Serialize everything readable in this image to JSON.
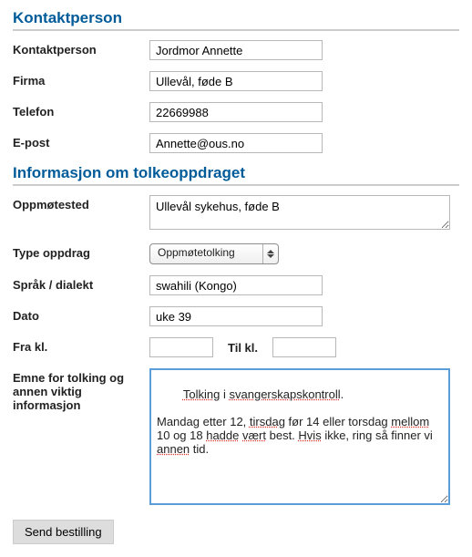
{
  "section1": {
    "title": "Kontaktperson"
  },
  "contact": {
    "person_label": "Kontaktperson",
    "person_value": "Jordmor Annette",
    "firm_label": "Firma",
    "firm_value": "Ullevål, føde B",
    "phone_label": "Telefon",
    "phone_value": "22669988",
    "email_label": "E-post",
    "email_value": "Annette@ous.no"
  },
  "section2": {
    "title": "Informasjon om tolkeoppdraget"
  },
  "job": {
    "meeting_label": "Oppmøtested",
    "meeting_value": "Ullevål sykehus, føde B",
    "type_label": "Type oppdrag",
    "type_value": "Oppmøtetolking",
    "language_label": "Språk / dialekt",
    "language_value": "swahili (Kongo)",
    "date_label": "Dato",
    "date_value": "uke 39",
    "from_label": "Fra kl.",
    "from_value": "",
    "to_label": "Til kl.",
    "to_value": "",
    "subject_label": "Emne for tolking og annen viktig informasjon",
    "subject_words": [
      {
        "t": "Tolking",
        "m": true
      },
      {
        "t": " i "
      },
      {
        "t": "svangerskapskontroll",
        "m": true
      },
      {
        "t": "."
      },
      {
        "t": "\n\n"
      },
      {
        "t": "Mandag etter 12, "
      },
      {
        "t": "tirsdag",
        "m": true
      },
      {
        "t": " før 14 eller torsdag "
      },
      {
        "t": "mellom",
        "m": true
      },
      {
        "t": " 10 og 18 "
      },
      {
        "t": "hadde",
        "m": true
      },
      {
        "t": " "
      },
      {
        "t": "vært",
        "m": true
      },
      {
        "t": " best. "
      },
      {
        "t": "Hvis",
        "m": true
      },
      {
        "t": " ikke, ring så finner vi "
      },
      {
        "t": "annen",
        "m": true
      },
      {
        "t": " tid."
      }
    ]
  },
  "submit_label": "Send bestilling"
}
